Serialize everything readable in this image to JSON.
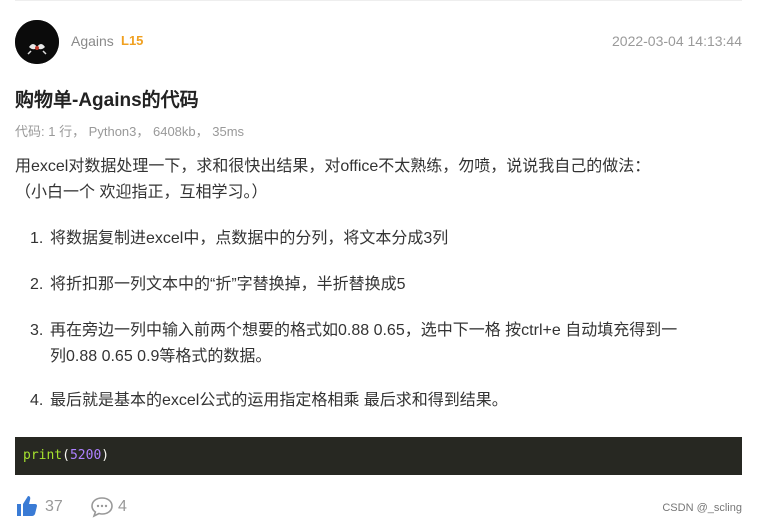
{
  "post": {
    "author": "Agains",
    "level": "L15",
    "timestamp": "2022-03-04 14:13:44",
    "title": "购物单-Agains的代码",
    "meta": "代码: 1 行， Python3， 6408kb， 35ms",
    "intro_line1": "用excel对数据处理一下，求和很快出结果，对office不太熟练，勿喷，说说我自己的做法：",
    "intro_line2": "（小白一个 欢迎指正，互相学习。）",
    "steps": [
      {
        "num": "1.",
        "text": "将数据复制进excel中，点数据中的分列，将文本分成3列"
      },
      {
        "num": "2.",
        "text": "将折扣那一列文本中的“折”字替换掉，半折替换成5"
      },
      {
        "num": "3.",
        "text": "再在旁边一列中输入前两个想要的格式如0.88 0.65，选中下一格 按ctrl+e 自动填充得到一",
        "text2": "列0.88 0.65 0.9等格式的数据。"
      },
      {
        "num": "4.",
        "text": "最后就是基本的excel公式的运用指定格相乘 最后求和得到结果。"
      }
    ],
    "code": {
      "func": "print",
      "open": "(",
      "arg": "5200",
      "close": ")"
    }
  },
  "footer": {
    "likes": "37",
    "comments": "4",
    "watermark": "CSDN @_scling",
    "like_icon": "thumbs-up-icon",
    "comment_icon": "comment-bubble-icon"
  },
  "colors": {
    "level": "#f0a020",
    "like": "#3a7bd5",
    "code_bg": "#272822"
  }
}
